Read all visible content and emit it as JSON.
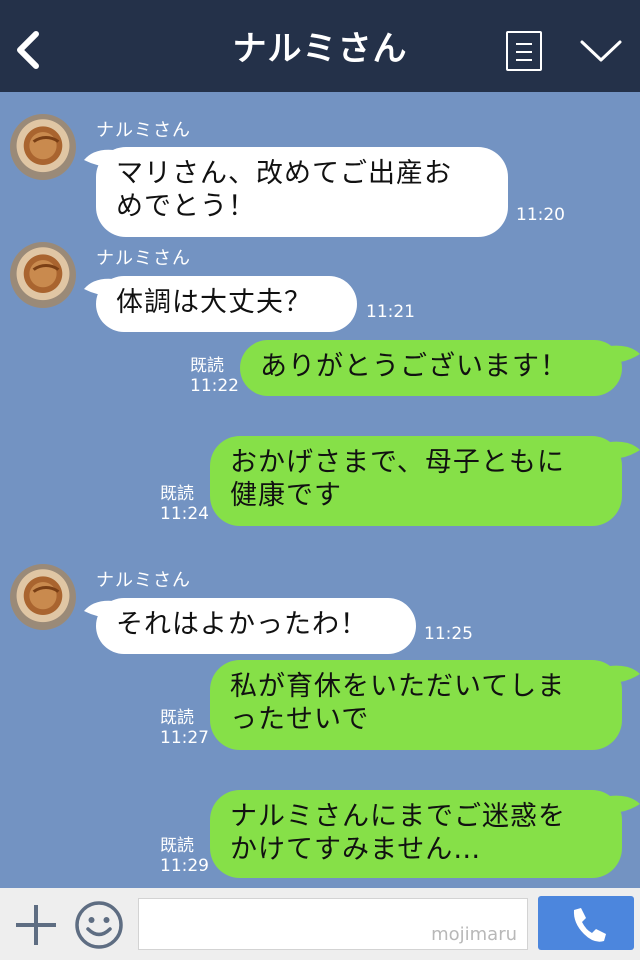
{
  "header": {
    "title": "ナルミさん",
    "back_icon": "chevron-left-icon",
    "menu_icon": "list-icon",
    "dropdown_icon": "chevron-down-icon",
    "background": "#243149"
  },
  "chat": {
    "background": "#7393c2",
    "incoming_color": "#ffffff",
    "outgoing_color": "#86e048",
    "messages": [
      {
        "direction": "in",
        "sender": "ナルミさん",
        "line1": "マリさん、改めてご出産お",
        "line2": "めでとう！",
        "time": "11:20"
      },
      {
        "direction": "in",
        "sender": "ナルミさん",
        "line1": "体調は大丈夫？",
        "time": "11:21"
      },
      {
        "direction": "out",
        "read": "既読",
        "line1": "ありがとうございます！",
        "time": "11:22"
      },
      {
        "direction": "out",
        "read": "既読",
        "line1": "おかげさまで、母子ともに",
        "line2": "健康です",
        "time": "11:24"
      },
      {
        "direction": "in",
        "sender": "ナルミさん",
        "line1": "それはよかったわ！",
        "time": "11:25"
      },
      {
        "direction": "out",
        "read": "既読",
        "line1": "私が育休をいただいてしま",
        "line2": "ったせいで",
        "time": "11:27"
      },
      {
        "direction": "out",
        "read": "既読",
        "line1": "ナルミさんにまでご迷惑を",
        "line2": "かけてすみません…",
        "time": "11:29"
      }
    ]
  },
  "footer": {
    "plus_icon": "plus-icon",
    "sticker_icon": "smiley-icon",
    "input_value": "",
    "watermark": "mojimaru",
    "send_icon": "phone-icon",
    "send_color": "#4c86dd"
  }
}
